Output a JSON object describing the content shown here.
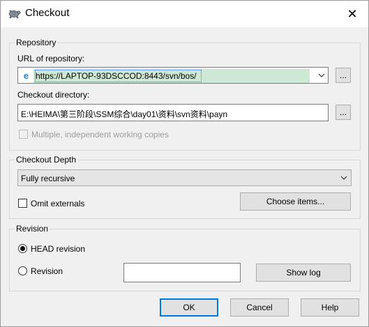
{
  "window": {
    "title": "Checkout",
    "close_label": "✕"
  },
  "repository": {
    "legend": "Repository",
    "url_label": "URL of repository:",
    "url_value": "https://LAPTOP-93DSCCOD:8443/svn/bos/",
    "browse_label": "...",
    "dir_label": "Checkout directory:",
    "dir_value": "E:\\HEIMA\\第三阶段\\SSM综合\\day01\\资料\\svn资料\\payn",
    "dir_browse_label": "...",
    "multiple_label": "Multiple, independent working copies",
    "multiple_checked": false,
    "multiple_enabled": false
  },
  "depth": {
    "legend": "Checkout Depth",
    "selected": "Fully recursive",
    "omit_label": "Omit externals",
    "omit_checked": false,
    "choose_label": "Choose items..."
  },
  "revision": {
    "legend": "Revision",
    "head_label": "HEAD revision",
    "head_checked": true,
    "revision_label": "Revision",
    "revision_value": "",
    "show_log_label": "Show log"
  },
  "footer": {
    "ok_label": "OK",
    "cancel_label": "Cancel",
    "help_label": "Help"
  },
  "colors": {
    "accent": "#0078d7",
    "url_highlight": "#cde8d4",
    "ie_icon": "#1e7bd6"
  }
}
